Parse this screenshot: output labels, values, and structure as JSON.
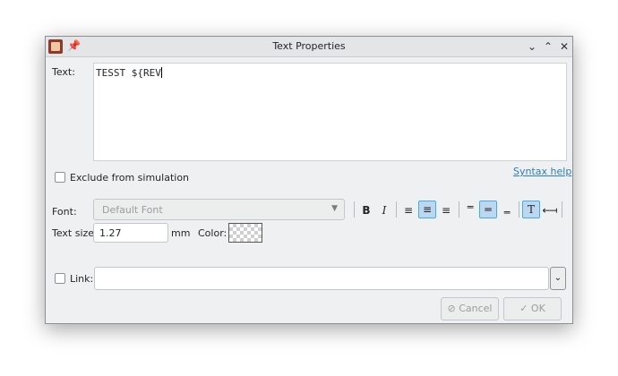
{
  "window": {
    "title": "Text Properties"
  },
  "text_label": "Text:",
  "text_value": "TESST ${REV",
  "exclude_checkbox": {
    "label": "Exclude from simulation",
    "checked": false
  },
  "syntax_help": "Syntax help",
  "font": {
    "label": "Font:",
    "value": "Default Font"
  },
  "format_buttons": {
    "bold": "B",
    "italic": "I"
  },
  "text_size": {
    "label": "Text size:",
    "value": "1.27",
    "unit": "mm"
  },
  "color_label": "Color:",
  "link": {
    "label": "Link:",
    "value": "",
    "checked": false
  },
  "buttons": {
    "cancel": "Cancel",
    "ok": "OK"
  },
  "icons": {
    "pin": "pin-icon",
    "minimize": "chevron-down-icon",
    "maximize": "chevron-up-icon",
    "close": "close-icon",
    "align_left": "align-left-icon",
    "align_center": "align-center-icon",
    "align_right": "align-right-icon",
    "valign_top": "valign-top-icon",
    "valign_center": "valign-center-icon",
    "valign_bottom": "valign-bottom-icon",
    "text_icon": "text-icon",
    "orientation": "orientation-icon"
  }
}
